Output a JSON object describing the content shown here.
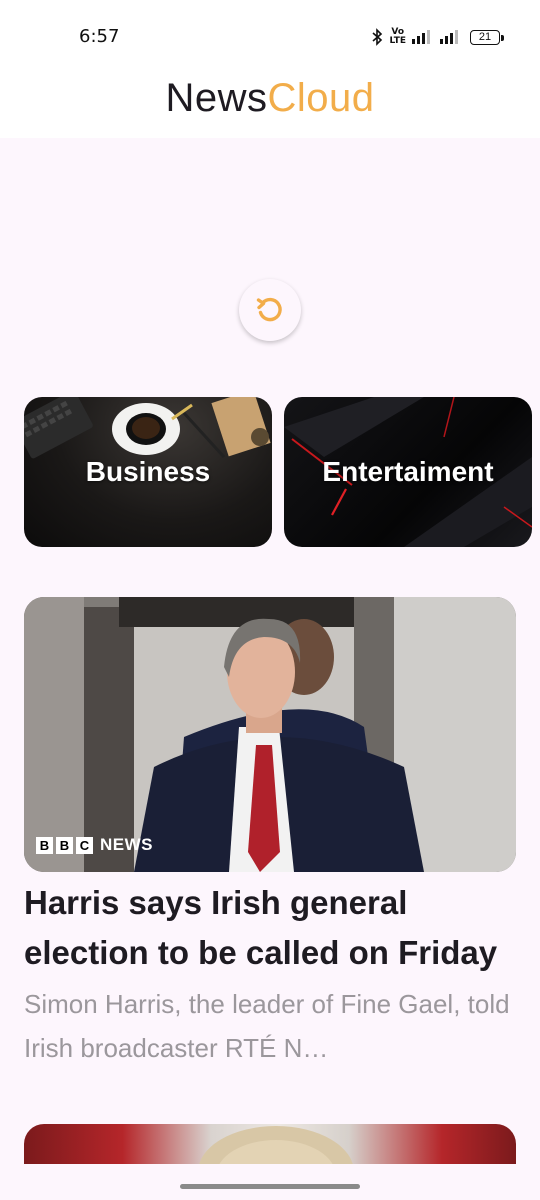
{
  "status_bar": {
    "time": "6:57",
    "volte_top": "Vo",
    "volte_bottom": "LTE",
    "battery": "21"
  },
  "header": {
    "title_part1": "News",
    "title_part2": "Cloud"
  },
  "colors": {
    "accent": "#f2ad4a",
    "background": "#fdf6fd"
  },
  "refresh_button": {
    "icon": "refresh-icon"
  },
  "categories": [
    {
      "label": "Business"
    },
    {
      "label": "Entertaiment"
    }
  ],
  "articles": [
    {
      "source": "NEWS",
      "source_letters": [
        "B",
        "B",
        "C"
      ],
      "headline": "Harris says Irish general election to be called on Friday",
      "description": "Simon Harris, the leader of Fine Gael, told Irish broadcaster RTÉ N…"
    }
  ]
}
